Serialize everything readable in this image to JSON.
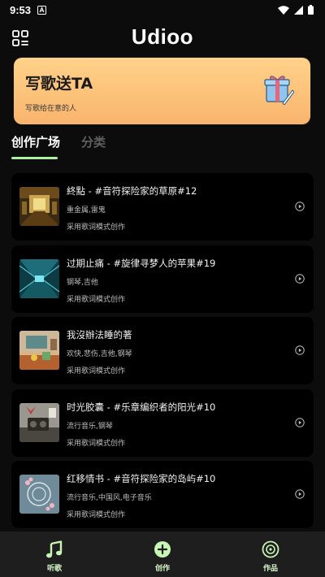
{
  "status_bar": {
    "time": "9:53"
  },
  "header": {
    "title": "Udioo",
    "menu_icon": "grid-icon"
  },
  "banner": {
    "title": "写歌送TA",
    "subtitle": "写歌给在意的人",
    "icon": "gift-icon"
  },
  "tabs": [
    {
      "label": "创作广场",
      "active": true
    },
    {
      "label": "分类",
      "active": false
    }
  ],
  "songs": [
    {
      "title": "終點 - #音符探险家的草原#12",
      "tags": "重金属,雷鬼",
      "mode": "采用歌词模式创作"
    },
    {
      "title": "过期止痛 - #旋律寻梦人的苹果#19",
      "tags": "钢琴,吉他",
      "mode": "采用歌词模式创作"
    },
    {
      "title": "我沒辦法睡的著",
      "tags": "欢快,悲伤,吉他,钢琴",
      "mode": "采用歌词模式创作"
    },
    {
      "title": "时光胶囊 - #乐章编织者的阳光#10",
      "tags": "流行音乐,钢琴",
      "mode": "采用歌词模式创作"
    },
    {
      "title": "红移情书 - #音符探险家的岛屿#10",
      "tags": "流行音乐,中国风,电子音乐",
      "mode": "采用歌词模式创作"
    }
  ],
  "bottom_nav": [
    {
      "label": "听歌",
      "icon": "music-note-icon"
    },
    {
      "label": "创作",
      "icon": "plus-circle-icon"
    },
    {
      "label": "作品",
      "icon": "disc-icon"
    }
  ],
  "colors": {
    "accent_green": "#a7f3a0",
    "banner_orange": "#f9b46d",
    "background": "#0c0c0c",
    "card": "#000000",
    "nav_bg": "#1e1e1e"
  }
}
